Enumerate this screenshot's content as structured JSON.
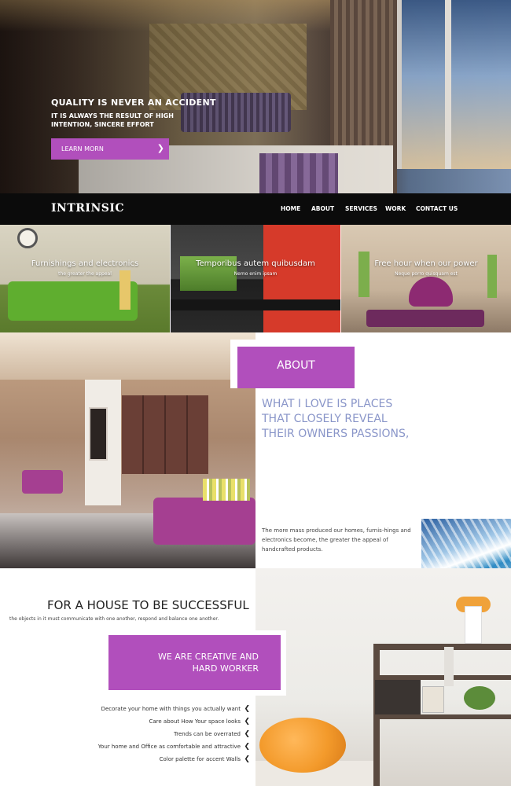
{
  "hero": {
    "title": "QUALITY IS NEVER AN ACCIDENT",
    "subtitle": "IT IS ALWAYS THE RESULT OF HIGH INTENTION, SINCERE EFFORT",
    "button_label": "LEARN MORN",
    "button_icon": "chevron-right-icon"
  },
  "navbar": {
    "logo": "INTRINSIC",
    "items": [
      "HOME",
      "ABOUT",
      "SERVICES",
      "WORK",
      "CONTACT US"
    ]
  },
  "features": [
    {
      "title": "Furnishings and electronics",
      "subtitle": "the greater the appeal"
    },
    {
      "title": "Temporibus autem quibusdam",
      "subtitle": "Nemo enim ipsam"
    },
    {
      "title": "Free hour when our power",
      "subtitle": "Neque porro quisquam est"
    }
  ],
  "about": {
    "label": "ABOUT",
    "heading": "WHAT I LOVE IS PLACES THAT CLOSELY REVEAL THEIR OWNERS PASSIONS,",
    "text": "The more mass produced our homes, furnis-hings and electronics become, the greater the appeal of handcrafted products."
  },
  "house": {
    "title": "FOR A HOUSE TO BE SUCCESSFUL",
    "subtitle": "the objects in it must communicate with one another, respond and balance one another."
  },
  "creative": {
    "line1": "WE ARE CREATIVE AND",
    "line2": "HARD WORKER"
  },
  "tips": [
    "Decorate your home with things you actually want",
    "Care about How Your space looks",
    "Trends can be overrated",
    "Your home and Office as comfortable and attractive",
    "Color palette for accent Walls"
  ],
  "colors": {
    "accent": "#b14fbc",
    "navbar": "#0b0b0b",
    "heading_blue": "#8a96c9"
  }
}
